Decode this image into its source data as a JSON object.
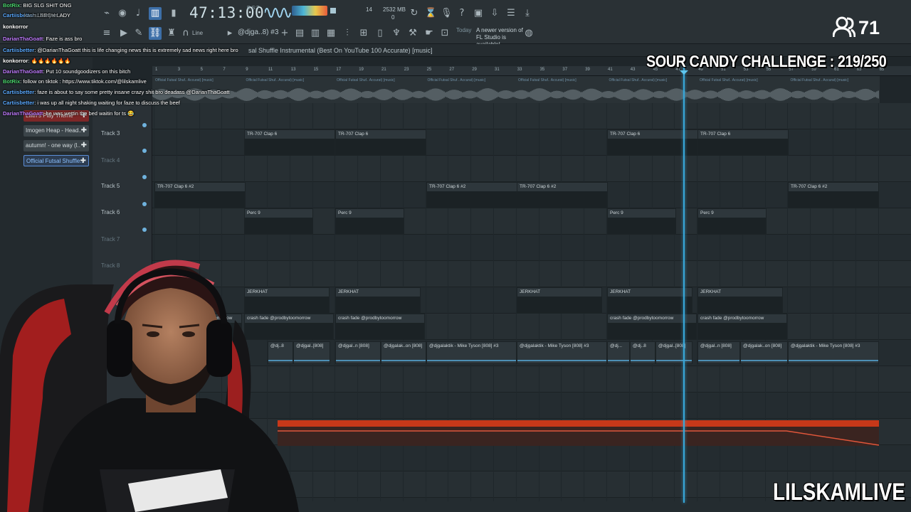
{
  "toolbar": {
    "clock": "47:13:00",
    "clock_sub": "B:S:T",
    "cpu": "14",
    "memory": "2532 MB",
    "memory_sub": "0",
    "snap_label": "Line",
    "pattern": "@djga..8) #3",
    "news_today": "Today",
    "news_text": "A newer version of FL Studio is available!"
  },
  "playlist": {
    "title": "sal Shuffle Instrumental (Best On YouTube 100 Accurate) [music]",
    "ticks": [
      "1",
      "3",
      "5",
      "7",
      "9",
      "11",
      "13",
      "15",
      "17",
      "19",
      "21",
      "23",
      "25",
      "27",
      "29",
      "31",
      "33",
      "35",
      "37",
      "39",
      "41",
      "43",
      "45",
      "47",
      "49",
      "51",
      "53",
      "55",
      "57",
      "59",
      "61",
      "63",
      "65"
    ],
    "audio_strip_label": "Official Futsal Shuf.. Accurat) [music]"
  },
  "tracks": [
    {
      "name": "Track 3",
      "dim": false
    },
    {
      "name": "Track 4",
      "dim": true
    },
    {
      "name": "Track 5",
      "dim": false
    },
    {
      "name": "Track 6",
      "dim": false
    },
    {
      "name": "Track 7",
      "dim": true
    },
    {
      "name": "Track 8",
      "dim": true
    }
  ],
  "clips": {
    "clap6": "TR-707 Clap 6",
    "clap6_2": "TR-707 Clap 6 #2",
    "perc9": "Perc 9",
    "jerkhat": "JERKHAT",
    "crash": "crash fade @prodbytoomorrow",
    "crash_cut": "omorrow",
    "tyson": "@djgalaktik - Mike Tyson [808] #3",
    "dj_short_a": "@dj..8",
    "dj_short_b": "@djgal..[808]",
    "dj_short_c": "@djgal..n [808]",
    "dj_short_d": "@djgalak..on [808]",
    "dj_short_e": "@dj..."
  },
  "browser": {
    "items": [
      {
        "label": "Lilith's Play Theme",
        "state": "red"
      },
      {
        "label": "Imogen Heap - Head..",
        "state": "normal"
      },
      {
        "label": "autumn! - one way (l..",
        "state": "normal"
      },
      {
        "label": "Official Futsal Shuffle..",
        "state": "active"
      }
    ]
  },
  "chat": [
    {
      "user": "BotRix",
      "color": "green",
      "msg": ": BIG SLG SHIT ONG"
    },
    {
      "user": "Cartiisbetter",
      "color": "blue",
      "msg": ": LEECH LADY"
    },
    {
      "user": "konkorror",
      "color": "white",
      "msg": ""
    },
    {
      "user": "DarianThaGoatt",
      "color": "purple",
      "msg": ": Faze is ass bro"
    },
    {
      "user": "Cartiisbetter",
      "color": "blue",
      "msg": ": @DarianThaGoatt this is life changing news this is extremely sad news right here bro"
    },
    {
      "user": "konkorror",
      "color": "white",
      "msg": ": 🔥🔥🔥🔥🔥🔥"
    },
    {
      "user": "DarianThaGoatt",
      "color": "purple",
      "msg": ": Put 10 soundgoodizers on this bitch"
    },
    {
      "user": "BotRix",
      "color": "green",
      "msg": ": follow on tiktok : https://www.tiktok.com/@lilskamlive"
    },
    {
      "user": "Cartiisbetter",
      "color": "blue",
      "msg": ": faze is about to say some pretty insane crazy shit bro deadass @DarianThaGoatt"
    },
    {
      "user": "Cartiisbetter",
      "color": "blue",
      "msg": ": i was up all night shaking waiting for faze to discuss the beef"
    },
    {
      "user": "DarianThaGoatt",
      "color": "purple",
      "msg": ": he was wettin the bed waitin for ts 😂"
    }
  ],
  "chat_extra": "kashu bunyan",
  "overlay": {
    "viewers": "71",
    "challenge": "SOUR CANDY CHALLENGE : 219/250",
    "brand": "LILSKAMLIVE"
  },
  "colors": {
    "playhead": "#37a7d9",
    "automation": "#c73819",
    "accent": "#5b8ed8"
  }
}
